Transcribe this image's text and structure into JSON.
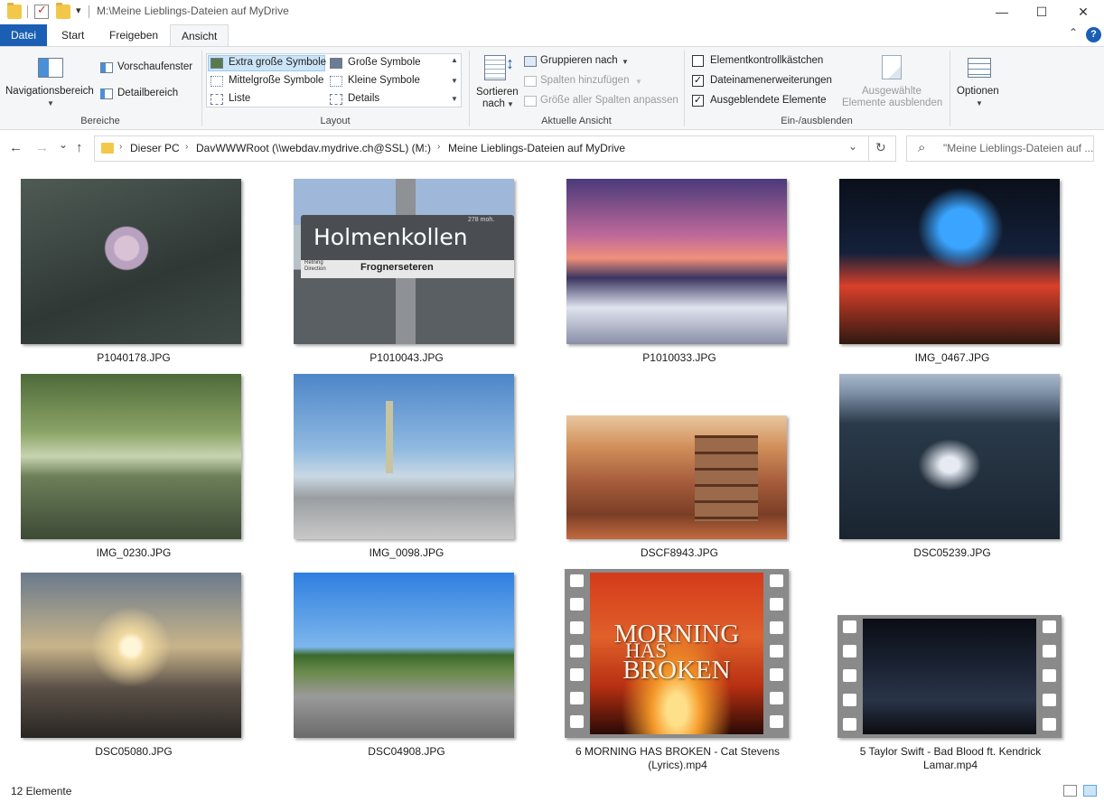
{
  "window": {
    "title": "M:\\Meine Lieblings-Dateien auf MyDrive",
    "minimize": "—",
    "maximize": "☐",
    "close": "✕"
  },
  "quick_access": {
    "dropdown": "▾"
  },
  "ribbon_tabs": [
    {
      "label": "Datei"
    },
    {
      "label": "Start"
    },
    {
      "label": "Freigeben"
    },
    {
      "label": "Ansicht"
    }
  ],
  "ribbon_collapse": "⌃",
  "help": "?",
  "ribbon": {
    "bereiche": {
      "label": "Bereiche",
      "nav_pane": "Navigationsbereich",
      "preview_pane": "Vorschaufenster",
      "details_pane": "Detailbereich"
    },
    "layout": {
      "label": "Layout",
      "items": [
        "Extra große Symbole",
        "Große Symbole",
        "Mittelgroße Symbole",
        "Kleine Symbole",
        "Liste",
        "Details"
      ],
      "selected": "Extra große Symbole"
    },
    "current_view": {
      "label": "Aktuelle Ansicht",
      "sort_line1": "Sortieren",
      "sort_line2": "nach",
      "group_by": "Gruppieren nach",
      "add_columns": "Spalten hinzufügen",
      "size_columns": "Größe aller Spalten anpassen"
    },
    "show_hide": {
      "label": "Ein-/ausblenden",
      "item_checkboxes": {
        "label": "Elementkontrollkästchen",
        "checked": false
      },
      "file_extensions": {
        "label": "Dateinamenerweiterungen",
        "checked": true
      },
      "hidden_items": {
        "label": "Ausgeblendete Elemente",
        "checked": true
      },
      "hide_selected_line1": "Ausgewählte",
      "hide_selected_line2": "Elemente ausblenden"
    },
    "options": {
      "label": "Optionen"
    }
  },
  "address_bar": {
    "back": "←",
    "forward": "→",
    "recent": "⌄",
    "up": "↑",
    "crumbs": [
      "Dieser PC",
      "DavWWWRoot (\\\\webdav.mydrive.ch@SSL) (M:)",
      "Meine Lieblings-Dateien auf MyDrive"
    ],
    "crumb_sep": "›",
    "dropdown": "⌄",
    "refresh": "↻"
  },
  "search": {
    "icon": "⌕",
    "placeholder": "\"Meine Lieblings-Dateien auf ..."
  },
  "files": [
    {
      "name": "P1040178.JPG",
      "kind": "photo"
    },
    {
      "name": "P1010043.JPG",
      "kind": "photo",
      "sign_text": "Holmenkollen",
      "sign_sub": "Frognerseteren",
      "sign_small": "278 moh.",
      "sign_small2": "Retning",
      "sign_small3": "Direction"
    },
    {
      "name": "P1010033.JPG",
      "kind": "photo"
    },
    {
      "name": "IMG_0467.JPG",
      "kind": "photo"
    },
    {
      "name": "IMG_0230.JPG",
      "kind": "photo"
    },
    {
      "name": "IMG_0098.JPG",
      "kind": "photo"
    },
    {
      "name": "DSCF8943.JPG",
      "kind": "photo"
    },
    {
      "name": "DSC05239.JPG",
      "kind": "photo"
    },
    {
      "name": "DSC05080.JPG",
      "kind": "photo"
    },
    {
      "name": "DSC04908.JPG",
      "kind": "photo"
    },
    {
      "name": "6 MORNING HAS BROKEN - Cat Stevens (Lyrics).mp4",
      "kind": "video",
      "thumb_text": [
        "MORNING",
        "HAS",
        "BROKEN"
      ]
    },
    {
      "name": "5 Taylor Swift - Bad Blood ft. Kendrick Lamar.mp4",
      "kind": "video"
    }
  ],
  "status": {
    "count": "12 Elemente"
  }
}
